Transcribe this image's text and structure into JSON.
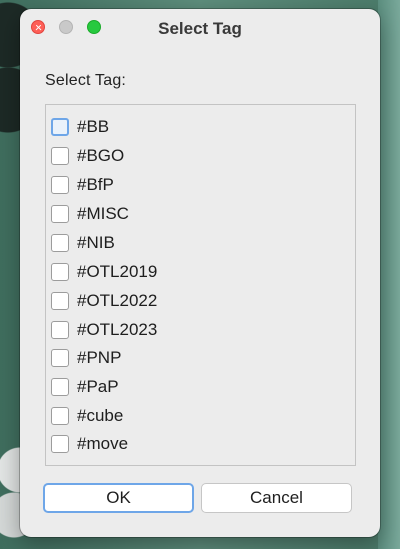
{
  "window": {
    "title": "Select Tag"
  },
  "prompt": "Select Tag:",
  "tags": [
    {
      "label": "#BB",
      "checked": false
    },
    {
      "label": "#BGO",
      "checked": false
    },
    {
      "label": "#BfP",
      "checked": false
    },
    {
      "label": "#MISC",
      "checked": false
    },
    {
      "label": "#NIB",
      "checked": false
    },
    {
      "label": "#OTL2019",
      "checked": false
    },
    {
      "label": "#OTL2022",
      "checked": false
    },
    {
      "label": "#OTL2023",
      "checked": false
    },
    {
      "label": "#PNP",
      "checked": false
    },
    {
      "label": "#PaP",
      "checked": false
    },
    {
      "label": "#cube",
      "checked": false
    },
    {
      "label": "#move",
      "checked": false
    }
  ],
  "buttons": {
    "ok": "OK",
    "cancel": "Cancel"
  },
  "colors": {
    "focus_ring": "#6ea6e8",
    "close": "#fe5f57",
    "minimize_inactive": "#c9c9c9",
    "maximize": "#27c93f"
  }
}
